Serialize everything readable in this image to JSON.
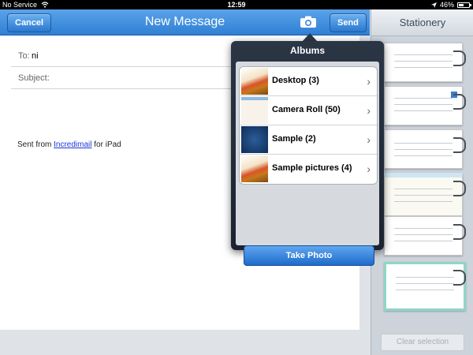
{
  "status_bar": {
    "carrier": "No Service",
    "time": "12:59",
    "battery": "46%",
    "battery_level": 0.46
  },
  "navbar": {
    "cancel_label": "Cancel",
    "title": "New Message",
    "send_label": "Send"
  },
  "compose": {
    "to_label": "To:",
    "to_value": "ni",
    "subject_label": "Subject:",
    "subject_value": "",
    "signature_prefix": "Sent from ",
    "signature_link": "Incredimail",
    "signature_suffix": " for iPad"
  },
  "albums": {
    "title": "Albums",
    "items": [
      {
        "label": "Desktop (3)",
        "thumb": "food"
      },
      {
        "label": "Camera Roll (50)",
        "thumb": "roll"
      },
      {
        "label": "Sample (2)",
        "thumb": "blue"
      },
      {
        "label": "Sample pictures (4)",
        "thumb": "food"
      }
    ],
    "take_photo_label": "Take Photo"
  },
  "stationery": {
    "title": "Stationery",
    "clear_label": "Clear selection"
  },
  "colors": {
    "accent": "#2f7fd3",
    "link": "#1a37d6"
  }
}
